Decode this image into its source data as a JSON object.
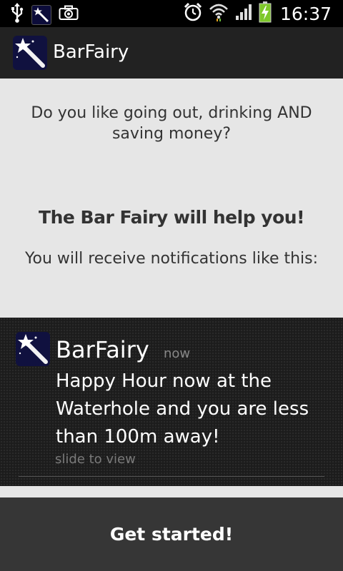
{
  "status_bar": {
    "time": "16:37",
    "left_icons": [
      "usb-icon",
      "app-notification-icon",
      "camera-icon"
    ],
    "right_icons": [
      "alarm-icon",
      "wifi-icon",
      "signal-icon",
      "battery-charging-icon"
    ],
    "battery_color": "#7ec82a"
  },
  "action_bar": {
    "title": "BarFairy",
    "icon": "magic-wand-icon"
  },
  "content": {
    "intro": "Do you like going out, drinking AND saving money?",
    "headline": "The Bar Fairy will help you!",
    "receive": "You will receive notifications like this:"
  },
  "notification": {
    "icon": "magic-wand-icon",
    "title": "BarFairy",
    "time": "now",
    "body": "Happy Hour now at the Waterhole and you are less than 100m away!",
    "hint": "slide to view"
  },
  "footer": {
    "button_label": "Get started!"
  },
  "colors": {
    "content_bg": "#e6e6e6",
    "action_bar_bg": "#222222",
    "notification_bg": "#1c1c1c",
    "button_bg": "#363636",
    "icon_bg": "#10113f"
  }
}
